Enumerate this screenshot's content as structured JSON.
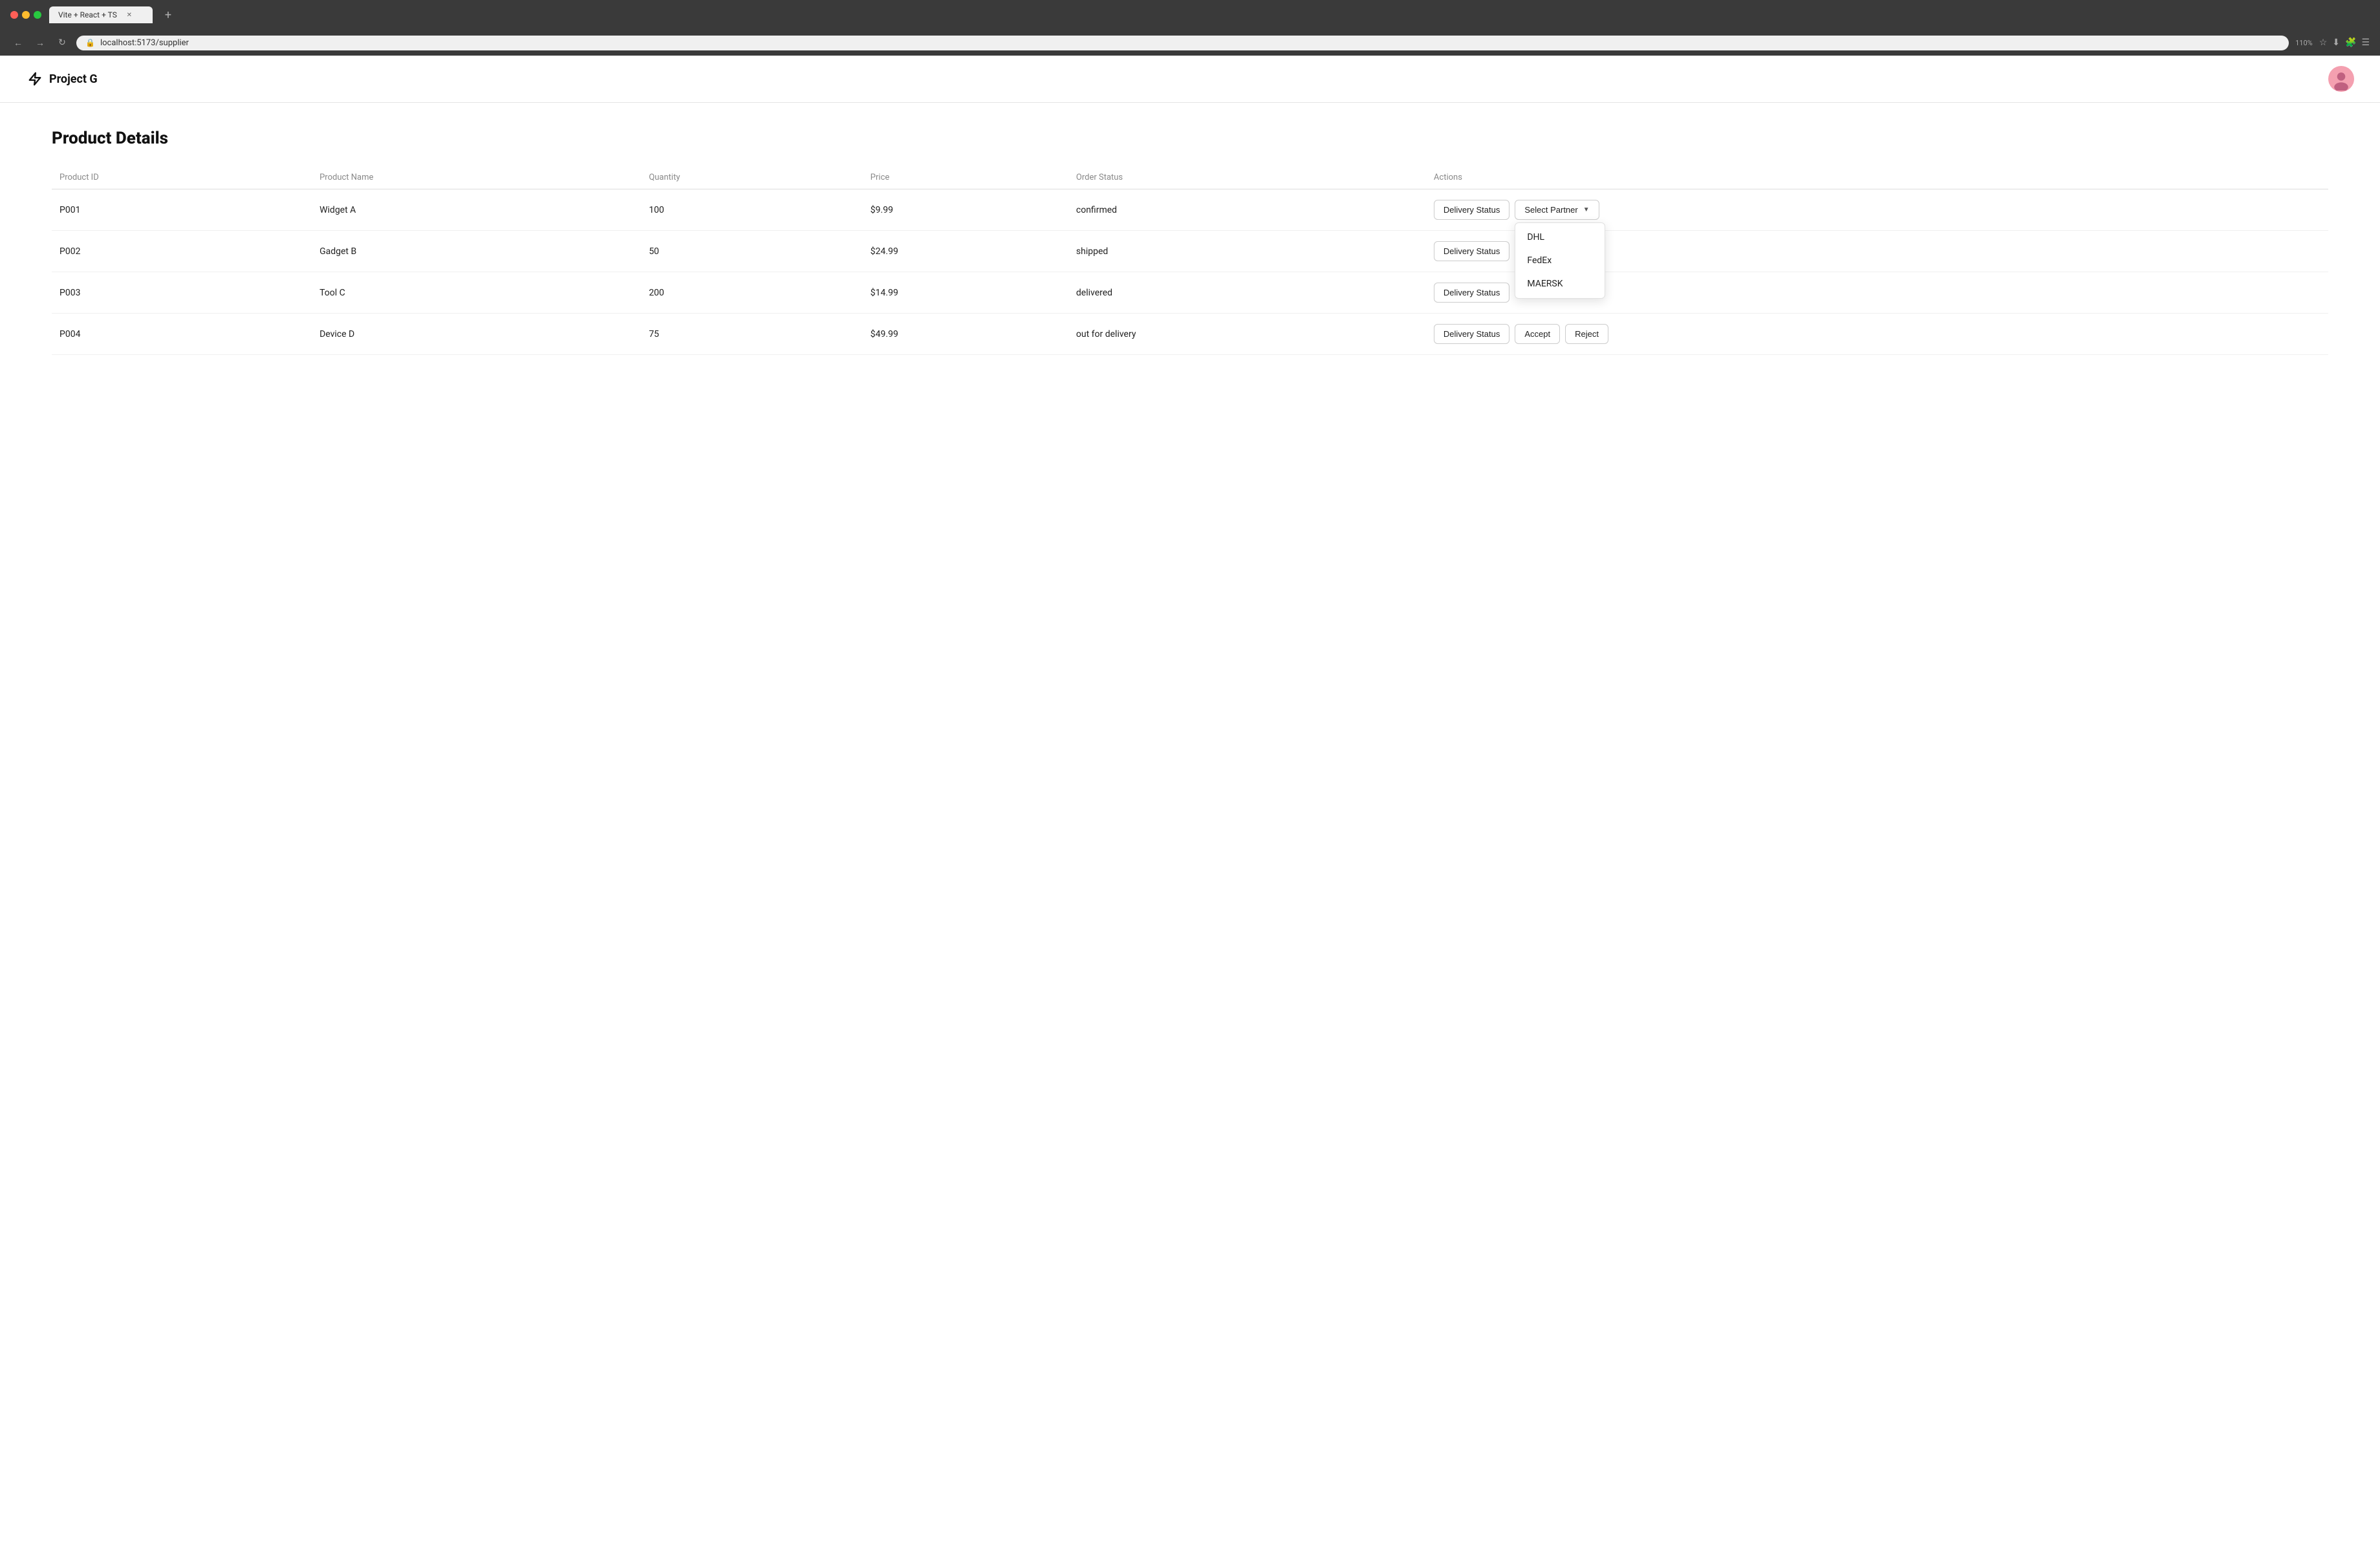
{
  "browser": {
    "tab_title": "Vite + React + TS",
    "url": "localhost:5173/supplier",
    "zoom": "110%"
  },
  "app": {
    "title": "Project G",
    "logo_icon": "⚡"
  },
  "page": {
    "title": "Product Details"
  },
  "table": {
    "columns": [
      "Product ID",
      "Product Name",
      "Quantity",
      "Price",
      "Order Status",
      "Actions"
    ],
    "rows": [
      {
        "id": "P001",
        "name": "Widget A",
        "quantity": "100",
        "price": "$9.99",
        "order_status": "confirmed",
        "show_select_partner": true,
        "show_accept_reject": false
      },
      {
        "id": "P002",
        "name": "Gadget B",
        "quantity": "50",
        "price": "$24.99",
        "order_status": "shipped",
        "show_select_partner": false,
        "show_accept_reject": false
      },
      {
        "id": "P003",
        "name": "Tool C",
        "quantity": "200",
        "price": "$14.99",
        "order_status": "delivered",
        "show_select_partner": false,
        "show_accept_reject": false
      },
      {
        "id": "P004",
        "name": "Device D",
        "quantity": "75",
        "price": "$49.99",
        "order_status": "out for delivery",
        "show_select_partner": false,
        "show_accept_reject": true
      }
    ],
    "delivery_status_label": "Delivery Status",
    "select_partner_label": "Select Partner",
    "accept_label": "Accept",
    "reject_label": "Reject",
    "partner_options": [
      "DHL",
      "FedEx",
      "MAERSK"
    ]
  }
}
